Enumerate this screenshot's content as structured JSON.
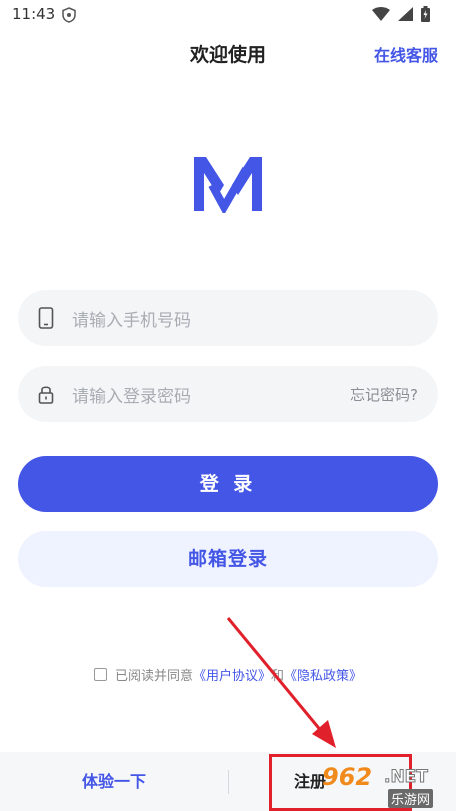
{
  "status": {
    "time": "11:43"
  },
  "header": {
    "title": "欢迎使用",
    "support_link": "在线客服"
  },
  "login_form": {
    "phone_placeholder": "请输入手机号码",
    "password_placeholder": "请输入登录密码",
    "forgot_password": "忘记密码?",
    "login_button": "登 录",
    "email_login_button": "邮箱登录"
  },
  "agreement": {
    "prefix": "已阅读并同意",
    "user_agreement": "《用户协议》",
    "conjunction": "和",
    "privacy_policy": "《隐私政策》"
  },
  "bottom_bar": {
    "trial": "体验一下",
    "register": "注册"
  },
  "watermark": {
    "number": "962",
    "suffix": ".NET",
    "site_name": "乐游网"
  },
  "colors": {
    "accent": "#4456e6",
    "annotation": "#e0202a"
  }
}
